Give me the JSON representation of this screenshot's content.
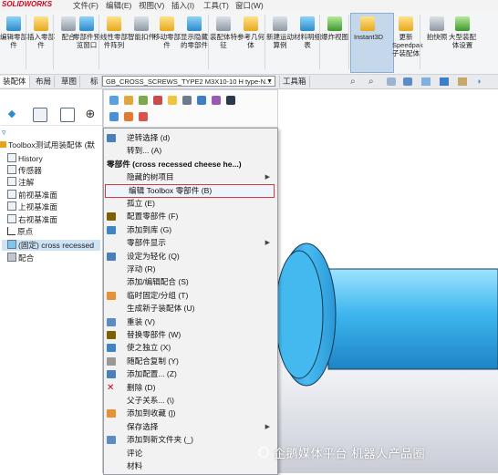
{
  "app": {
    "logo": "SOLIDWORKS"
  },
  "menubar": [
    "文件(F)",
    "编辑(E)",
    "视图(V)",
    "插入(I)",
    "工具(T)",
    "窗口(W)"
  ],
  "ribbon": {
    "buttons": [
      {
        "label": "编辑零部件",
        "icon": "edit-component-icon",
        "color": "blue"
      },
      {
        "label": "插入零部件",
        "icon": "insert-component-icon",
        "color": "yellow"
      },
      {
        "label": "配合",
        "icon": "mate-icon",
        "color": "gray"
      },
      {
        "label": "零部件预览窗口",
        "icon": "component-preview-icon",
        "color": "blue"
      },
      {
        "label": "线性零部件阵列",
        "icon": "linear-pattern-icon",
        "color": "yellow"
      },
      {
        "label": "智能扣件",
        "icon": "smart-fasteners-icon",
        "color": "gray"
      },
      {
        "label": "移动零部件",
        "icon": "move-component-icon",
        "color": "yellow"
      },
      {
        "label": "显示隐藏的零部件",
        "icon": "show-hidden-icon",
        "color": "blue"
      },
      {
        "label": "装配体特征",
        "icon": "assembly-features-icon",
        "color": "gray"
      },
      {
        "label": "参考几何体",
        "icon": "reference-geometry-icon",
        "color": "yellow"
      },
      {
        "label": "新建运动算例",
        "icon": "motion-study-icon",
        "color": "gray"
      },
      {
        "label": "材料明细表",
        "icon": "bom-icon",
        "color": "blue"
      },
      {
        "label": "爆炸视图",
        "icon": "exploded-view-icon",
        "color": "green"
      },
      {
        "label": "Instant3D",
        "icon": "instant3d-icon",
        "color": "yellow"
      },
      {
        "label": "更新Speedpak子装配体",
        "icon": "speedpak-icon",
        "color": "yellow"
      },
      {
        "label": "拍快照",
        "icon": "snapshot-icon",
        "color": "gray"
      },
      {
        "label": "大型装配体设置",
        "icon": "large-assembly-icon",
        "color": "green"
      }
    ]
  },
  "tabs": [
    "装配体",
    "布局",
    "草图",
    "标"
  ],
  "tabs_right": "工具箱",
  "dropdown": {
    "value": "GB_CROSS_SCREWS_TYPE2 M3X10-10  H type-N..."
  },
  "tree": {
    "root": "Toolbox测试用装配体 (默",
    "items": [
      {
        "label": "History",
        "icon": "history-icon"
      },
      {
        "label": "传感器",
        "icon": "sensor-icon"
      },
      {
        "label": "注解",
        "icon": "annotation-icon"
      },
      {
        "label": "前视基准面",
        "icon": "plane-icon"
      },
      {
        "label": "上视基准面",
        "icon": "plane-icon"
      },
      {
        "label": "右视基准面",
        "icon": "plane-icon"
      },
      {
        "label": "原点",
        "icon": "origin-icon"
      },
      {
        "label": "(固定) cross recessed",
        "icon": "part-icon"
      },
      {
        "label": "配合",
        "icon": "mates-folder-icon"
      }
    ]
  },
  "context_menu": {
    "items": [
      {
        "label": "逆转选择 (d)",
        "icon": "reverse-select-icon"
      },
      {
        "label": "转到... (A)",
        "icon": ""
      },
      {
        "label": "零部件 (cross recessed cheese he...)",
        "header": true
      },
      {
        "label": "隐藏的树项目",
        "submenu": true
      },
      {
        "label": "编辑 Toolbox 零部件 (B)",
        "highlight": true
      },
      {
        "label": "孤立 (E)",
        "icon": ""
      },
      {
        "label": "配置零部件 (F)",
        "icon": "configure-icon"
      },
      {
        "label": "添加到库 (G)",
        "icon": "add-library-icon"
      },
      {
        "label": "零部件显示",
        "submenu": true
      },
      {
        "label": "设定为轻化 (Q)",
        "icon": "lightweight-icon"
      },
      {
        "label": "浮动 (R)",
        "icon": ""
      },
      {
        "label": "添加/编辑配合 (S)",
        "icon": ""
      },
      {
        "label": "临时固定/分组 (T)",
        "icon": "fix-group-icon"
      },
      {
        "label": "生成新子装配体 (U)",
        "icon": ""
      },
      {
        "label": "重装 (V)",
        "icon": "reload-icon"
      },
      {
        "label": "替换零部件 (W)",
        "icon": "replace-icon"
      },
      {
        "label": "使之独立 (X)",
        "icon": "independent-icon"
      },
      {
        "label": "随配合复制 (Y)",
        "icon": "copy-mates-icon"
      },
      {
        "label": "添加配置... (Z)",
        "icon": "add-config-icon"
      },
      {
        "label": "删除 (D)",
        "icon": "delete-icon"
      },
      {
        "label": "父子关系... (\\)",
        "icon": ""
      },
      {
        "label": "添加到收藏 (])",
        "icon": "favorite-icon"
      },
      {
        "label": "保存选择",
        "submenu": true
      },
      {
        "label": "添加到新文件夹 (_)",
        "icon": "new-folder-icon"
      },
      {
        "label": "评论",
        "icon": ""
      },
      {
        "label": "材料",
        "icon": ""
      }
    ]
  },
  "watermark": "企鹅媒体平台 机器人产品圈",
  "colors": {
    "accent": "#e0363a",
    "part": "#3fb8f0",
    "selection": "#cfe3f7"
  }
}
